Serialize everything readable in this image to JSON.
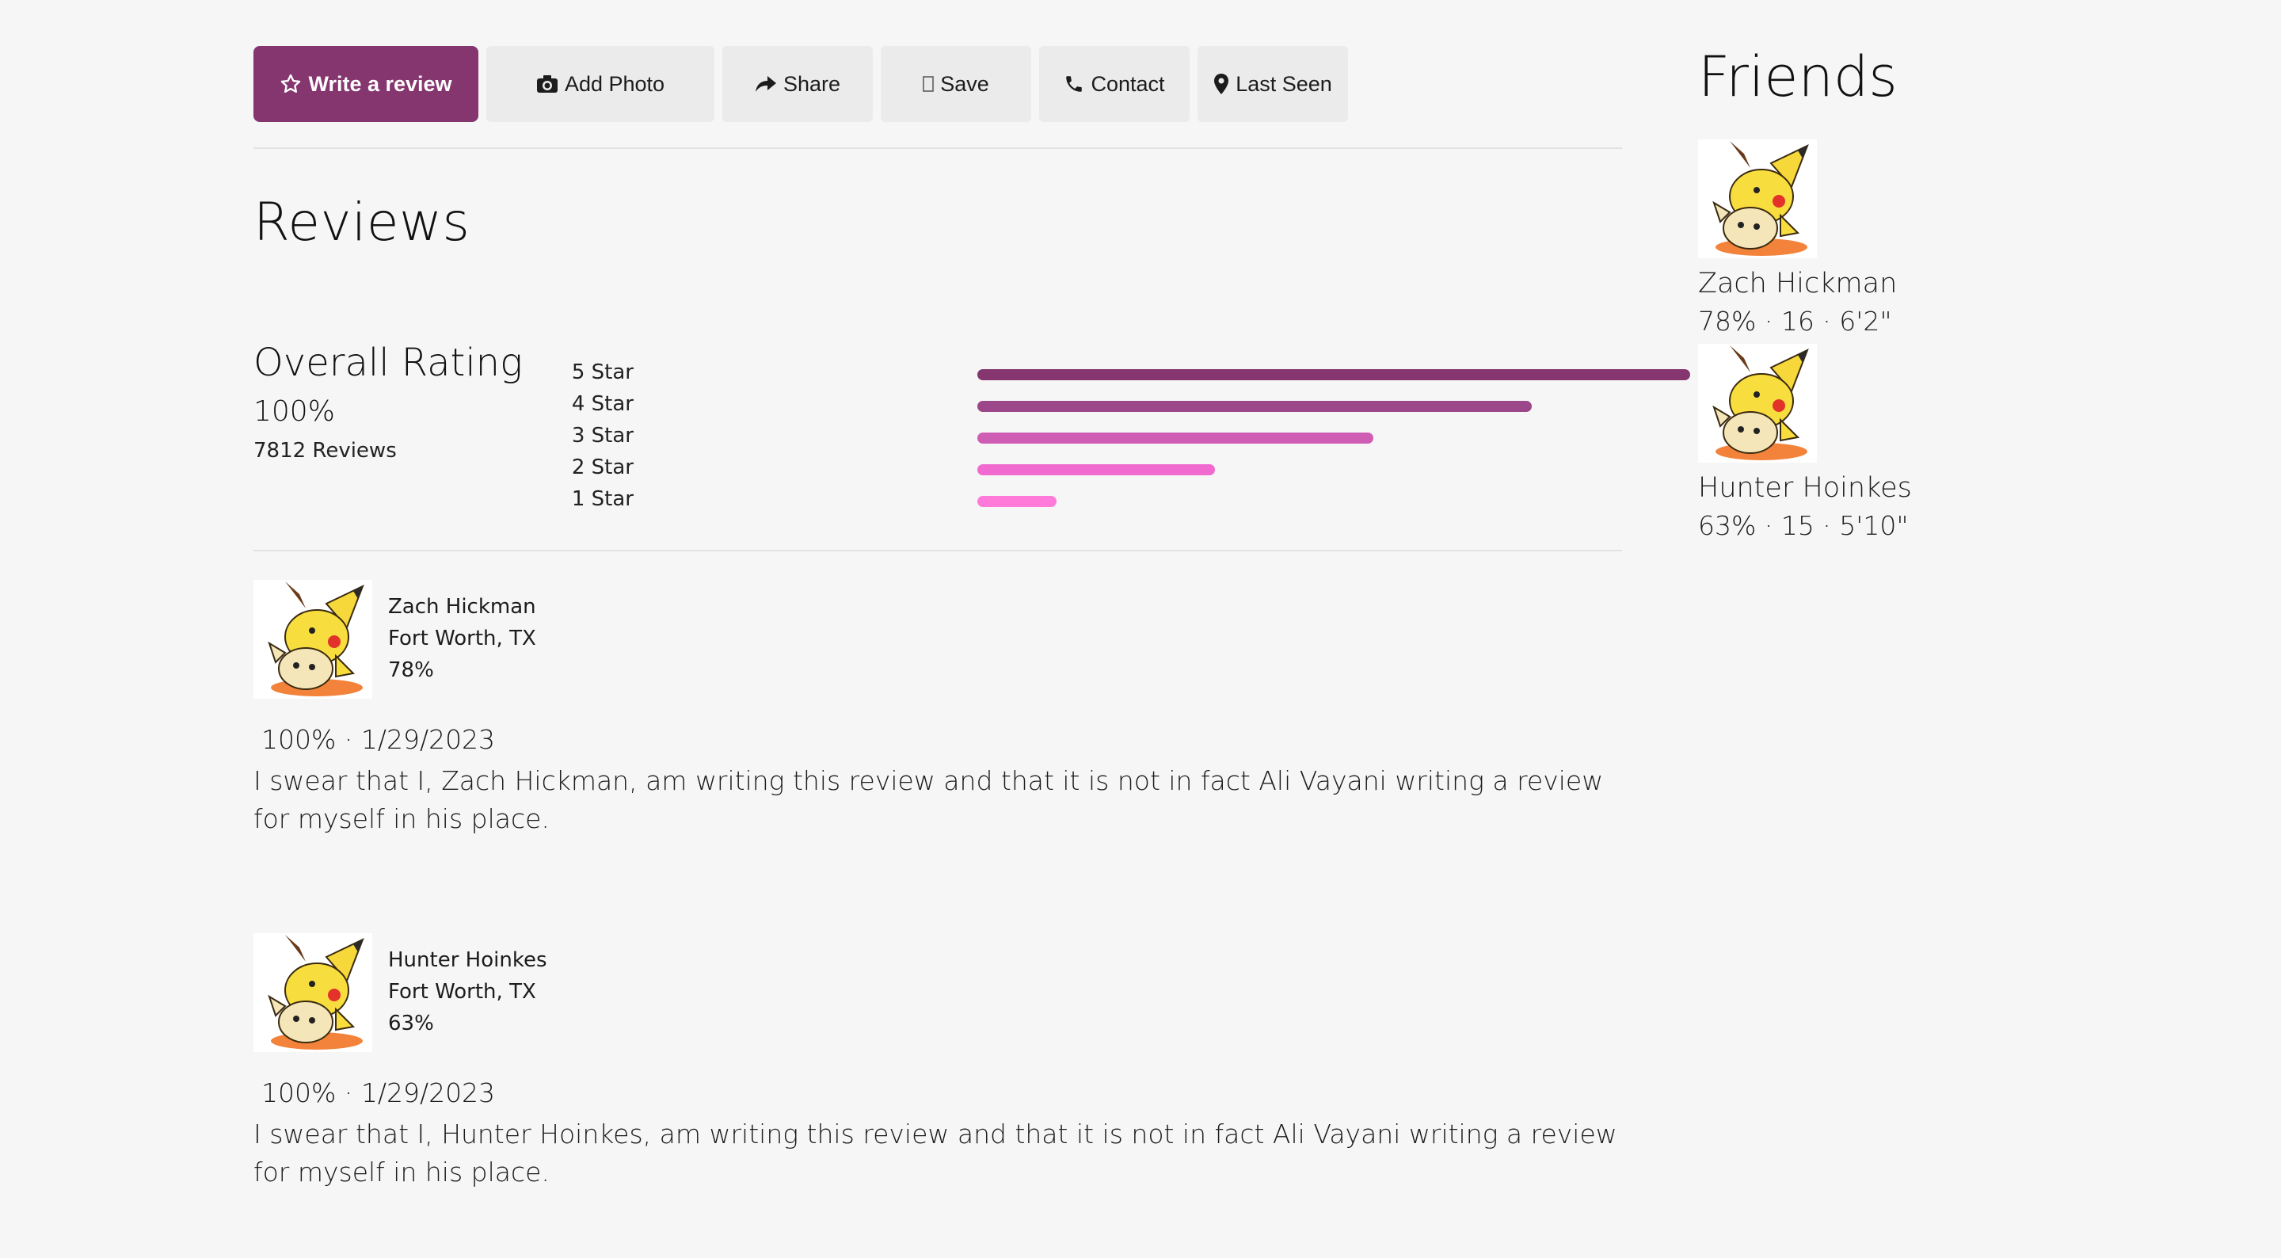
{
  "toolbar": {
    "write_review": "Write a review",
    "add_photo": "Add Photo",
    "share": "Share",
    "save": "Save",
    "contact": "Contact",
    "last_seen": "Last Seen"
  },
  "reviews_title": "Reviews",
  "overall": {
    "title": "Overall Rating",
    "percent": "100%",
    "count": "7812 Reviews"
  },
  "rating_bars": [
    {
      "label": "5 Star",
      "fraction": 1.0,
      "color": "#85366e"
    },
    {
      "label": "4 Star",
      "fraction": 0.778,
      "color": "#9c4789"
    },
    {
      "label": "3 Star",
      "fraction": 0.556,
      "color": "#d05db4"
    },
    {
      "label": "2 Star",
      "fraction": 0.333,
      "color": "#f06ad0"
    },
    {
      "label": "1 Star",
      "fraction": 0.111,
      "color": "#ff7ad9"
    }
  ],
  "reviews": [
    {
      "name": "Zach Hickman",
      "location": "Fort Worth, TX",
      "score": "78%",
      "rating": "100%",
      "date": "1/29/2023",
      "text": "I swear that I, Zach Hickman, am writing this review and that it is not in fact Ali Vayani writing a review for myself in his place."
    },
    {
      "name": "Hunter Hoinkes",
      "location": "Fort Worth, TX",
      "score": "63%",
      "rating": "100%",
      "date": "1/29/2023",
      "text": "I swear that I, Hunter Hoinkes, am writing this review and that it is not in fact Ali Vayani writing a review for myself in his place."
    }
  ],
  "friends": {
    "title": "Friends",
    "list": [
      {
        "name": "Zach Hickman",
        "stats": "78% · 16 · 6'2\""
      },
      {
        "name": "Hunter Hoinkes",
        "stats": "63% · 15 · 5'10\""
      }
    ]
  },
  "separator": "·"
}
